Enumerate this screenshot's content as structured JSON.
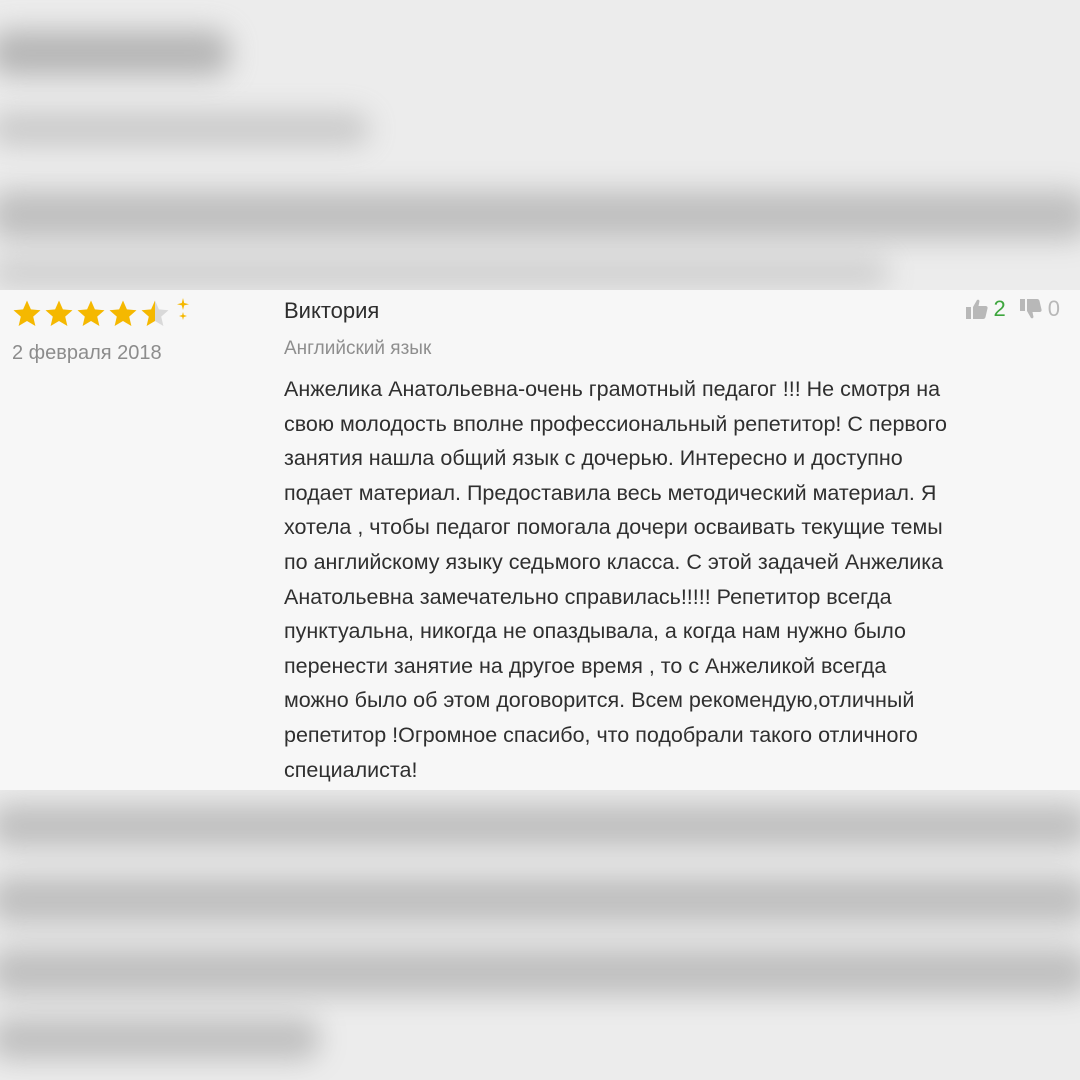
{
  "review": {
    "rating": 4.5,
    "rating_max": 5,
    "date": "2 февраля 2018",
    "author": "Виктория",
    "subject": "Английский язык",
    "likes": "2",
    "dislikes": "0",
    "text_lines": [
      "Анжелика Анатольевна-очень грамотный педагог !!! Не смотря на",
      "свою молодость вполне профессиональный репетитор! С первого",
      "занятия нашла общий язык с дочерью. Интересно и доступно",
      "подает материал. Предоставила весь методический материал. Я",
      "хотела , чтобы педагог помогала дочери осваивать текущие темы",
      "по английскому языку седьмого класса. С этой задачей Анжелика",
      "Анатольевна замечательно справилась!!!!! Репетитор всегда",
      "пунктуальна, никогда не опаздывала, а когда нам нужно было",
      "перенести занятие на другое время , то с Анжеликой всегда",
      "можно было об этом договорится. Всем рекомендую,отличный",
      "репетитор !Огромное спасибо, что подобрали такого отличного",
      "специалиста!"
    ]
  },
  "icons": {
    "star": "star-icon",
    "half_star": "half-star-icon",
    "like": "thumbs-up-icon",
    "dislike": "thumbs-down-icon"
  },
  "colors": {
    "star": "#f5b800",
    "likes": "#3da63d",
    "dislikes": "#b8b8b8",
    "date": "#8c8c8c"
  }
}
